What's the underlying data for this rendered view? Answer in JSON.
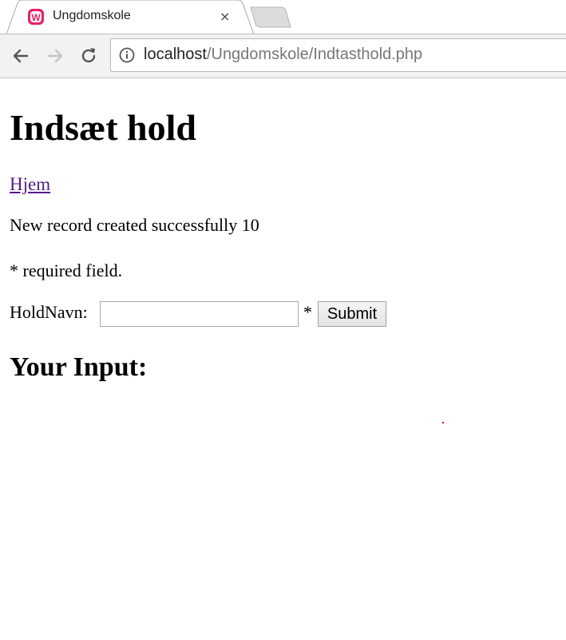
{
  "browser": {
    "tab": {
      "title": "Ungdomskole",
      "close_glyph": "×",
      "favicon": "wampserver-icon",
      "favicon_letter": "W",
      "favicon_color": "#e91e63"
    },
    "address_bar": {
      "host": "localhost",
      "path": "/Ungdomskole/Indtasthold.php"
    }
  },
  "page": {
    "heading": "Indsæt hold",
    "home_link": "Hjem",
    "status_message": "New record created successfully 10",
    "required_note": "* required field.",
    "form": {
      "label": "HoldNavn:",
      "value": "",
      "required_star": "*",
      "submit_label": "Submit"
    },
    "your_input_heading": "Your Input:"
  },
  "colors": {
    "link_visited": "#551a8b",
    "marker_dot": "#e00000"
  }
}
